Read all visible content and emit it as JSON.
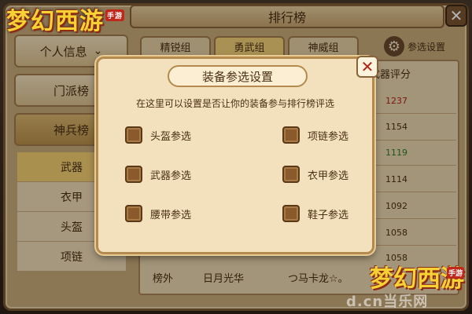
{
  "logo": {
    "text": "梦幻西游",
    "tag": "手游"
  },
  "window": {
    "title": "排行榜"
  },
  "sidebar": {
    "items": [
      {
        "label": "个人信息",
        "chevron": "⌄"
      },
      {
        "label": "门派榜"
      },
      {
        "label": "神兵榜"
      }
    ],
    "sub_items": [
      {
        "label": "武器"
      },
      {
        "label": "衣甲"
      },
      {
        "label": "头盔"
      },
      {
        "label": "项链"
      }
    ]
  },
  "tabs": [
    {
      "label": "精锐组"
    },
    {
      "label": "勇武组"
    },
    {
      "label": "神威组"
    }
  ],
  "settings_button": {
    "label": "参选设置"
  },
  "table": {
    "column_header": "武器评分",
    "scores": [
      "1237",
      "1154",
      "1119",
      "1114",
      "1092",
      "1058",
      "1058"
    ],
    "bottom_row": {
      "rank": "榜外",
      "name": "日月光华",
      "guild": "つ马卡龙☆。"
    }
  },
  "modal": {
    "title": "装备参选设置",
    "description": "在这里可以设置是否让你的装备参与排行榜评选",
    "options": [
      {
        "label": "头盔参选"
      },
      {
        "label": "项链参选"
      },
      {
        "label": "武器参选"
      },
      {
        "label": "衣甲参选"
      },
      {
        "label": "腰带参选"
      },
      {
        "label": "鞋子参选"
      }
    ]
  },
  "watermark": "d.cn当乐网",
  "colors": {
    "score_red": "#b0241a",
    "score_green": "#2c7a2c",
    "score_default": "#4a2f14"
  }
}
